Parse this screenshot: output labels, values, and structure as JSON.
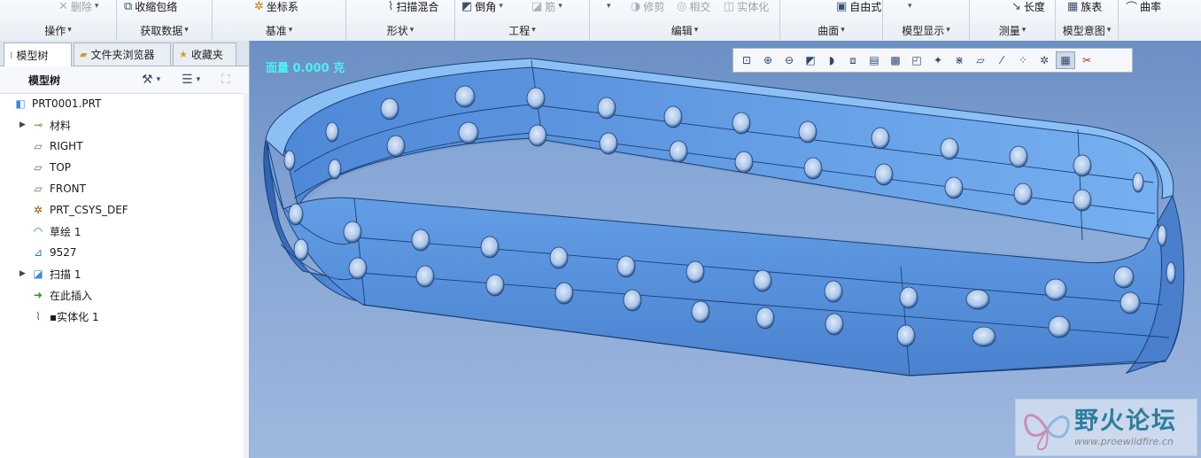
{
  "ribbon": {
    "top_tools": [
      {
        "label": "删除",
        "icon": "x-delete-icon",
        "disabled": true,
        "dropdown": true
      },
      {
        "label": "收缩包络",
        "icon": "shrinkwrap-icon",
        "disabled": false,
        "dropdown": false
      },
      {
        "label": "坐标系",
        "icon": "csys-icon",
        "disabled": false,
        "dropdown": false
      },
      {
        "label": "扫描混合",
        "icon": "swept-blend-icon",
        "disabled": false,
        "dropdown": false
      },
      {
        "label": "倒角",
        "icon": "chamfer-icon",
        "disabled": false,
        "dropdown": true
      },
      {
        "label": "筋",
        "icon": "rib-icon",
        "disabled": true,
        "dropdown": true
      },
      {
        "label": "",
        "icon": "dropdown-icon",
        "disabled": false,
        "dropdown": true
      },
      {
        "label": "修剪",
        "icon": "trim-icon",
        "disabled": true,
        "dropdown": false
      },
      {
        "label": "相交",
        "icon": "intersect-icon",
        "disabled": true,
        "dropdown": false
      },
      {
        "label": "实体化",
        "icon": "solidify-icon",
        "disabled": true,
        "dropdown": false
      },
      {
        "label": "自由式",
        "icon": "freestyle-icon",
        "disabled": false,
        "dropdown": false
      },
      {
        "label": "",
        "icon": "display-icon",
        "disabled": false,
        "dropdown": true
      },
      {
        "label": "长度",
        "icon": "length-icon",
        "disabled": false,
        "dropdown": false
      },
      {
        "label": "族表",
        "icon": "family-table-icon",
        "disabled": false,
        "dropdown": false
      },
      {
        "label": "曲率",
        "icon": "curvature-icon",
        "disabled": false,
        "dropdown": false
      }
    ],
    "groups": [
      {
        "label": "操作"
      },
      {
        "label": "获取数据"
      },
      {
        "label": "基准"
      },
      {
        "label": "形状"
      },
      {
        "label": "工程"
      },
      {
        "label": "编辑"
      },
      {
        "label": "曲面"
      },
      {
        "label": "模型显示"
      },
      {
        "label": "测量"
      },
      {
        "label": "模型意图"
      }
    ]
  },
  "left_panel": {
    "tabs": [
      {
        "label": "模型树",
        "icon": "model-tree-icon",
        "active": true
      },
      {
        "label": "文件夹浏览器",
        "icon": "folder-icon",
        "active": false
      },
      {
        "label": "收藏夹",
        "icon": "favorites-icon",
        "active": false
      }
    ],
    "tree_title": "模型树",
    "tree_items": [
      {
        "label": "PRT0001.PRT",
        "icon": "part-icon",
        "expandable": false
      },
      {
        "label": "材料",
        "icon": "material-icon",
        "expandable": true
      },
      {
        "label": "RIGHT",
        "icon": "datum-plane-icon",
        "expandable": false
      },
      {
        "label": "TOP",
        "icon": "datum-plane-icon",
        "expandable": false
      },
      {
        "label": "FRONT",
        "icon": "datum-plane-icon",
        "expandable": false
      },
      {
        "label": "PRT_CSYS_DEF",
        "icon": "csys-icon",
        "expandable": false
      },
      {
        "label": "草绘 1",
        "icon": "sketch-icon",
        "expandable": false
      },
      {
        "label": "9527",
        "icon": "graph-icon",
        "expandable": false
      },
      {
        "label": "扫描 1",
        "icon": "sweep-icon",
        "expandable": true
      },
      {
        "label": "在此插入",
        "icon": "insert-here-arrow-icon",
        "expandable": false
      },
      {
        "label": "实体化 1",
        "icon": "solidify-icon",
        "expandable": false
      }
    ]
  },
  "viewport": {
    "status_text": "面量 0.000 克",
    "toolbar_icons": [
      "refit-icon",
      "zoom-in-icon",
      "zoom-out-icon",
      "repaint-icon",
      "display-style-icon",
      "saved-views-icon",
      "view-manager-icon",
      "perspective-icon",
      "spin-center-icon",
      "annotation-display-icon",
      "datum-planes-icon",
      "datum-axes-icon",
      "datum-points-icon",
      "csys-display-icon",
      "plane-tag-icon",
      "selection-filter-icon",
      "appearance-icon"
    ],
    "background_top": "#6b8fc4",
    "model_color": "#5f97e0"
  },
  "watermark": {
    "title": "野火论坛",
    "url": "www.proewildfire.cn"
  }
}
